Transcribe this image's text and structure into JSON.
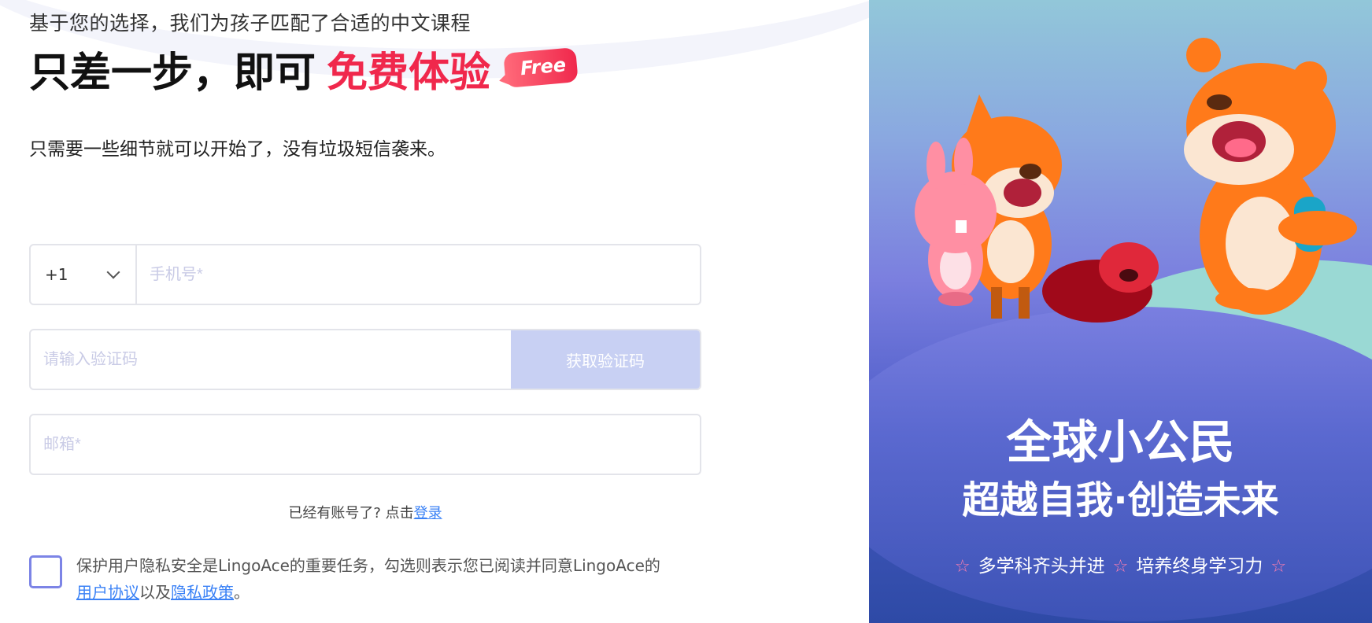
{
  "header": {
    "subtitle": "基于您的选择，我们为孩子匹配了合适的中文课程",
    "title_main": "只差一步，即可",
    "title_accent": "免费体验",
    "free_badge": "Free",
    "description": "只需要一些细节就可以开始了，没有垃圾短信袭来。"
  },
  "form": {
    "country_code": "+1",
    "phone_placeholder": "手机号*",
    "code_placeholder": "请输入验证码",
    "get_code_label": "获取验证码",
    "email_placeholder": "邮箱*"
  },
  "login": {
    "prompt": "已经有账号了? 点击",
    "link_label": "登录"
  },
  "agreement": {
    "text": "保护用户隐私安全是LingoAce的重要任务，勾选则表示您已阅读并同意LingoAce的",
    "user_agreement": "用户协议",
    "and": "以及",
    "privacy_policy": "隐私政策",
    "end": "。"
  },
  "promo": {
    "slogan_line1": "全球小公民",
    "slogan_line2": "超越自我·创造未来",
    "tag1": "多学科齐头并进",
    "tag2": "培养终身学习力",
    "star_icon": "☆"
  },
  "colors": {
    "accent": "#f0284c",
    "link": "#3b82f6",
    "button_disabled": "#c8d0f3",
    "checkbox_border": "#7c84e6"
  }
}
